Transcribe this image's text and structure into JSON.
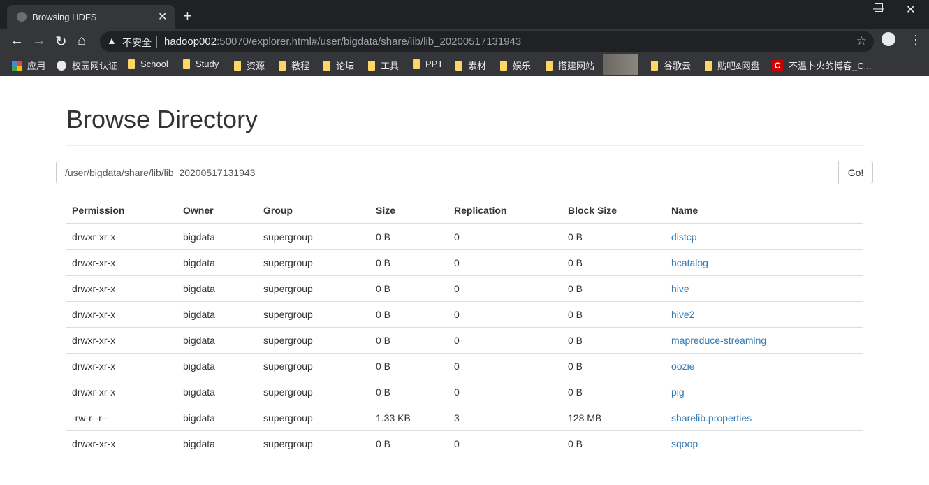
{
  "browser": {
    "tab_title": "Browsing HDFS",
    "insecure_label": "不安全",
    "url_host": "hadoop002",
    "url_rest": ":50070/explorer.html#/user/bigdata/share/lib/lib_20200517131943",
    "bookmarks": [
      "应用",
      "校园网认证",
      "School",
      "Study",
      "资源",
      "教程",
      "论坛",
      "工具",
      "PPT",
      "素材",
      "娱乐",
      "搭建网站",
      "谷歌云",
      "贴吧&网盘",
      "不温卜火的博客_C..."
    ]
  },
  "page": {
    "title": "Browse Directory",
    "path_value": "/user/bigdata/share/lib/lib_20200517131943",
    "go_label": "Go!",
    "columns": [
      "Permission",
      "Owner",
      "Group",
      "Size",
      "Replication",
      "Block Size",
      "Name"
    ],
    "rows": [
      [
        "drwxr-xr-x",
        "bigdata",
        "supergroup",
        "0 B",
        "0",
        "0 B",
        "distcp"
      ],
      [
        "drwxr-xr-x",
        "bigdata",
        "supergroup",
        "0 B",
        "0",
        "0 B",
        "hcatalog"
      ],
      [
        "drwxr-xr-x",
        "bigdata",
        "supergroup",
        "0 B",
        "0",
        "0 B",
        "hive"
      ],
      [
        "drwxr-xr-x",
        "bigdata",
        "supergroup",
        "0 B",
        "0",
        "0 B",
        "hive2"
      ],
      [
        "drwxr-xr-x",
        "bigdata",
        "supergroup",
        "0 B",
        "0",
        "0 B",
        "mapreduce-streaming"
      ],
      [
        "drwxr-xr-x",
        "bigdata",
        "supergroup",
        "0 B",
        "0",
        "0 B",
        "oozie"
      ],
      [
        "drwxr-xr-x",
        "bigdata",
        "supergroup",
        "0 B",
        "0",
        "0 B",
        "pig"
      ],
      [
        "-rw-r--r--",
        "bigdata",
        "supergroup",
        "1.33 KB",
        "3",
        "128 MB",
        "sharelib.properties"
      ],
      [
        "drwxr-xr-x",
        "bigdata",
        "supergroup",
        "0 B",
        "0",
        "0 B",
        "sqoop"
      ]
    ]
  },
  "colors": {
    "link": "#337ab7",
    "chrome_dark": "#202124",
    "chrome_toolbar": "#35363a"
  }
}
